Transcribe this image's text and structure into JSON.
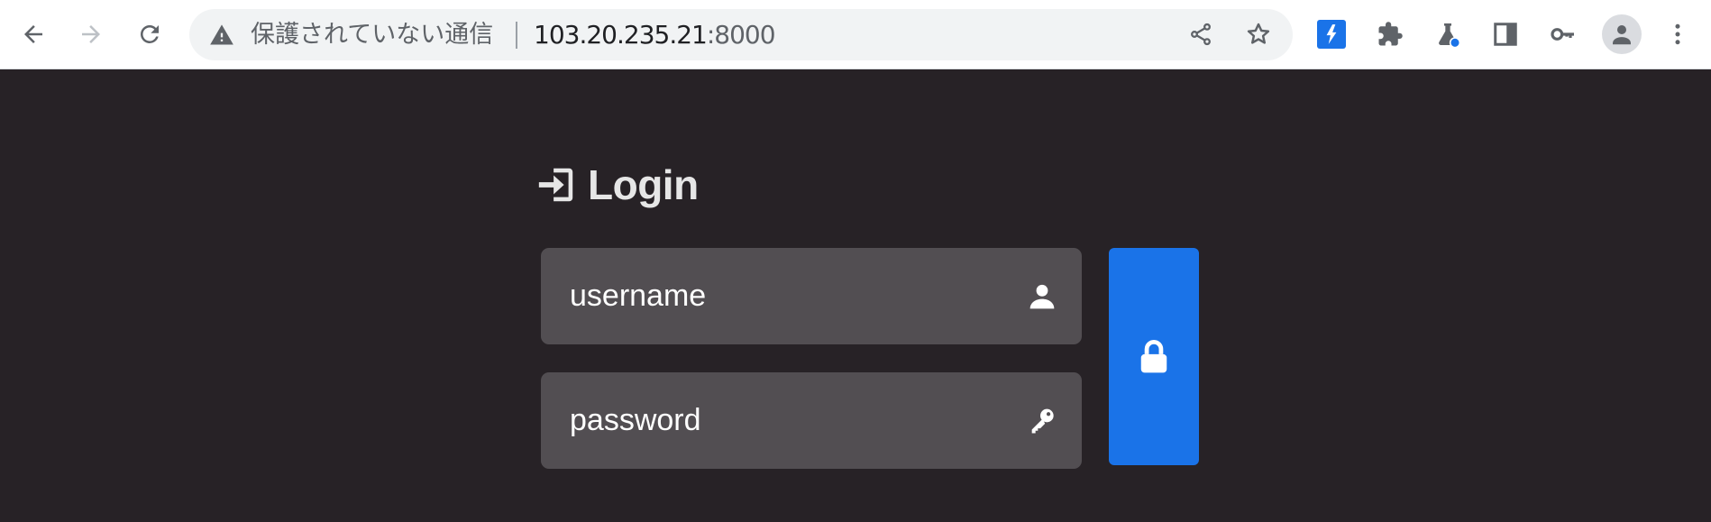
{
  "browser": {
    "security_label": "保護されていない通信",
    "url_host": "103.20.235.21",
    "url_port": ":8000",
    "icons": {
      "back": "back-arrow-icon",
      "forward": "forward-arrow-icon",
      "reload": "reload-icon",
      "warning": "warning-triangle-icon",
      "share": "share-icon",
      "bookmark": "star-icon",
      "extension_1": "plug-extension-icon",
      "extensions": "puzzle-icon",
      "labs": "flask-icon",
      "side_panel": "side-panel-icon",
      "passwords": "key-icon",
      "profile": "person-icon",
      "menu": "more-vertical-icon"
    },
    "colors": {
      "toolbar_bg": "#ffffff",
      "omnibox_bg": "#f1f3f4",
      "accent": "#1a73e8"
    }
  },
  "login": {
    "title": "Login",
    "username_placeholder": "username",
    "password_placeholder": "password",
    "icons": {
      "title": "sign-in-icon",
      "username": "user-icon",
      "password": "key-icon",
      "submit": "lock-icon"
    },
    "colors": {
      "page_bg": "#272226",
      "field_bg": "#524e52",
      "button_bg": "#1a73e8",
      "text": "#ffffff"
    }
  }
}
